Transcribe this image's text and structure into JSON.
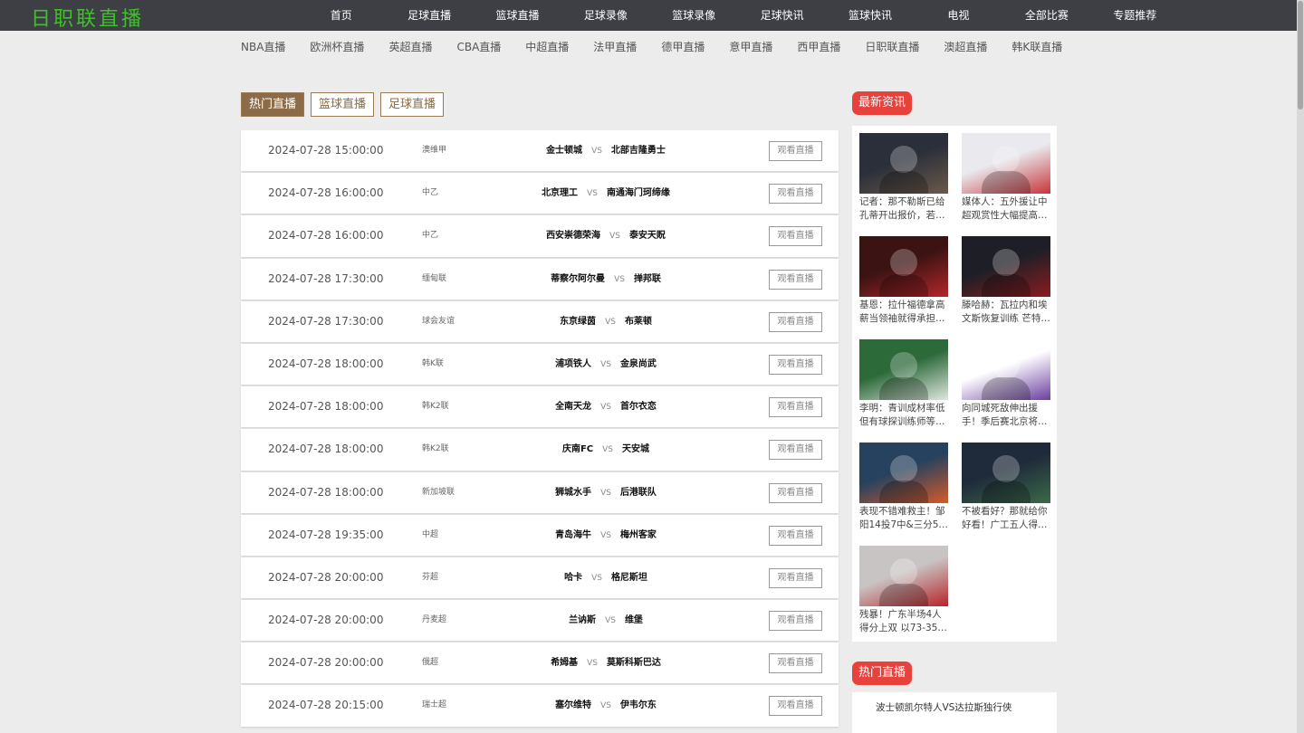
{
  "logo": "日职联直播",
  "nav": [
    "首页",
    "足球直播",
    "篮球直播",
    "足球录像",
    "篮球录像",
    "足球快讯",
    "篮球快讯",
    "电视",
    "全部比赛",
    "专题推荐"
  ],
  "subnav": [
    "NBA直播",
    "欧洲杯直播",
    "英超直播",
    "CBA直播",
    "中超直播",
    "法甲直播",
    "德甲直播",
    "意甲直播",
    "西甲直播",
    "日职联直播",
    "澳超直播",
    "韩K联直播"
  ],
  "tabs": [
    "热门直播",
    "篮球直播",
    "足球直播"
  ],
  "watch_label": "观看直播",
  "vs_label": "VS",
  "matches": [
    {
      "time": "2024-07-28 15:00:00",
      "league": "澳维甲",
      "home": "金士顿城",
      "away": "北部吉隆勇士"
    },
    {
      "time": "2024-07-28 16:00:00",
      "league": "中乙",
      "home": "北京理工",
      "away": "南通海门珂缔缘"
    },
    {
      "time": "2024-07-28 16:00:00",
      "league": "中乙",
      "home": "西安崇德荣海",
      "away": "泰安天贶"
    },
    {
      "time": "2024-07-28 17:30:00",
      "league": "缅甸联",
      "home": "蒂察尔阿尔曼",
      "away": "掸邦联"
    },
    {
      "time": "2024-07-28 17:30:00",
      "league": "球会友谊",
      "home": "东京绿茵",
      "away": "布莱顿"
    },
    {
      "time": "2024-07-28 18:00:00",
      "league": "韩K联",
      "home": "浦项铁人",
      "away": "金泉尚武"
    },
    {
      "time": "2024-07-28 18:00:00",
      "league": "韩K2联",
      "home": "全南天龙",
      "away": "首尔衣恋"
    },
    {
      "time": "2024-07-28 18:00:00",
      "league": "韩K2联",
      "home": "庆南FC",
      "away": "天安城"
    },
    {
      "time": "2024-07-28 18:00:00",
      "league": "新加坡联",
      "home": "狮城水手",
      "away": "后港联队"
    },
    {
      "time": "2024-07-28 19:35:00",
      "league": "中超",
      "home": "青岛海牛",
      "away": "梅州客家"
    },
    {
      "time": "2024-07-28 20:00:00",
      "league": "芬超",
      "home": "哈卡",
      "away": "格尼斯坦"
    },
    {
      "time": "2024-07-28 20:00:00",
      "league": "丹麦超",
      "home": "兰讷斯",
      "away": "维堡"
    },
    {
      "time": "2024-07-28 20:00:00",
      "league": "俄超",
      "home": "希姆基",
      "away": "莫斯科斯巴达"
    },
    {
      "time": "2024-07-28 20:15:00",
      "league": "瑞士超",
      "home": "塞尔维特",
      "away": "伊韦尔东"
    }
  ],
  "news_title": "最新资讯",
  "news": [
    {
      "caption": "记者：那不勒斯已给孔蒂开出报价，若…",
      "icon": "coach-photo",
      "colors": [
        "#2b2f3a",
        "#6b5a4a"
      ]
    },
    {
      "caption": "媒体人：五外援让中超观赏性大幅提高…",
      "icon": "player-photo",
      "colors": [
        "#e9e9ee",
        "#c8343a"
      ]
    },
    {
      "caption": "基恩：拉什福德拿高薪当领袖就得承担…",
      "icon": "player-photo",
      "colors": [
        "#3b1313",
        "#b3262a"
      ]
    },
    {
      "caption": "滕哈赫：瓦拉内和埃文斯恢复训练 芒特…",
      "icon": "press-photo",
      "colors": [
        "#1e1f26",
        "#8b1c22"
      ]
    },
    {
      "caption": "李明：青训成材率低但有球探训练师等…",
      "icon": "press-photo",
      "colors": [
        "#2d6a3a",
        "#dfe6e0"
      ]
    },
    {
      "caption": "向同城死敌伸出援手！季后赛北京将…",
      "icon": "club-logo",
      "colors": [
        "#ffffff",
        "#6b3fa0"
      ]
    },
    {
      "caption": "表现不错难救主！邹阳14投7中&三分5…",
      "icon": "basketball-photo",
      "colors": [
        "#26425e",
        "#d65a2a"
      ]
    },
    {
      "caption": "不被看好？那就给你好看！广工五人得…",
      "icon": "basketball-photo",
      "colors": [
        "#1f2a3a",
        "#3a6a4a"
      ]
    },
    {
      "caption": "残暴！广东半场4人得分上双 以73-35…",
      "icon": "basketball-photo",
      "colors": [
        "#c9c4c4",
        "#b8242a"
      ]
    }
  ],
  "hot_title": "热门直播",
  "hot_item": "波士顿凯尔特人VS达拉斯独行侠",
  "colors": {
    "topbar": "#3d3f45",
    "logo": "#3ec12a",
    "accent": "#8c6c48",
    "badge": "#e8423d"
  }
}
